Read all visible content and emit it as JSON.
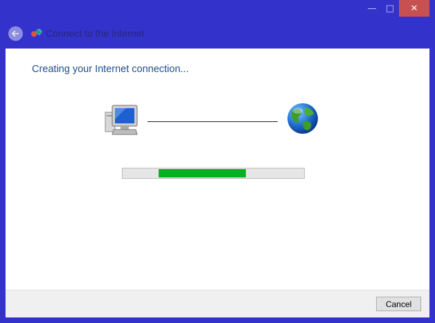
{
  "window": {
    "title": "Connect to the Internet",
    "controls": {
      "minimize": "—",
      "maximize": "□",
      "close": "✕"
    }
  },
  "main": {
    "heading": "Creating your Internet connection..."
  },
  "progress": {
    "indeterminate": true,
    "fill_start_fraction": 0.2,
    "fill_end_fraction": 0.68,
    "color": "#06b025"
  },
  "footer": {
    "cancel_label": "Cancel"
  },
  "icons": [
    "back-arrow-icon",
    "network-icon",
    "computer-icon",
    "globe-icon"
  ],
  "colors": {
    "frame": "#3333cc",
    "heading": "#1f4e8c",
    "progress": "#06b025"
  }
}
